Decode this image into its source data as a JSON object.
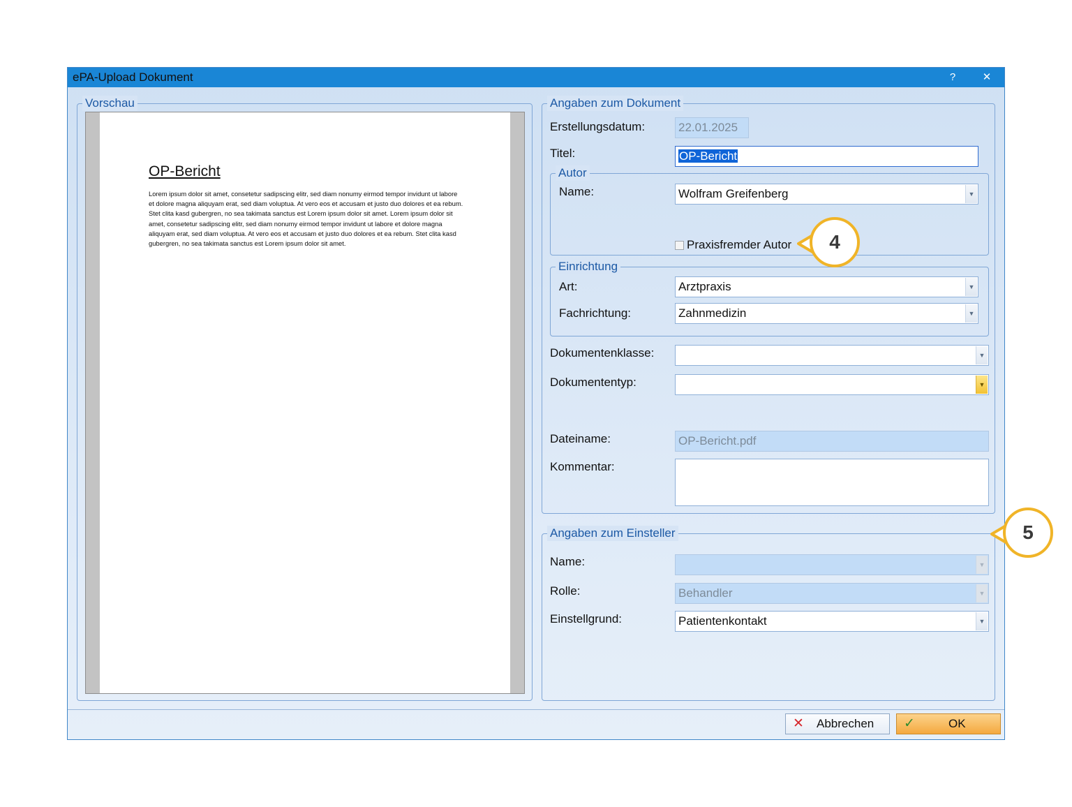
{
  "window": {
    "title": "ePA-Upload Dokument",
    "help_label": "?",
    "close_label": "✕"
  },
  "preview": {
    "legend": "Vorschau",
    "doc_title": "OP-Bericht",
    "doc_text": "Lorem ipsum dolor sit amet, consetetur sadipscing elitr, sed diam nonumy eirmod tempor invidunt ut labore et dolore magna aliquyam erat, sed diam voluptua. At vero eos et accusam et justo duo dolores et ea rebum. Stet clita kasd gubergren, no sea takimata sanctus est Lorem ipsum dolor sit amet. Lorem ipsum dolor sit amet, consetetur sadipscing elitr, sed diam nonumy eirmod tempor invidunt ut labore et dolore magna aliquyam erat, sed diam voluptua. At vero eos et accusam et justo duo dolores et ea rebum. Stet clita kasd gubergren, no sea takimata sanctus est Lorem ipsum dolor sit amet."
  },
  "document": {
    "legend": "Angaben zum Dokument",
    "erstellungsdatum_label": "Erstellungsdatum:",
    "erstellungsdatum_value": "22.01.2025",
    "titel_label": "Titel:",
    "titel_value": "OP-Bericht",
    "autor": {
      "legend": "Autor",
      "name_label": "Name:",
      "name_value": "Wolfram Greifenberg",
      "praxisfremd_label": "Praxisfremder Autor",
      "praxisfremd_checked": false
    },
    "einrichtung": {
      "legend": "Einrichtung",
      "art_label": "Art:",
      "art_value": "Arztpraxis",
      "fach_label": "Fachrichtung:",
      "fach_value": "Zahnmedizin"
    },
    "klasse_label": "Dokumentenklasse:",
    "klasse_value": "",
    "typ_label": "Dokumententyp:",
    "typ_value": "",
    "dateiname_label": "Dateiname:",
    "dateiname_value": "OP-Bericht.pdf",
    "kommentar_label": "Kommentar:",
    "kommentar_value": ""
  },
  "einsteller": {
    "legend": "Angaben zum Einsteller",
    "name_label": "Name:",
    "name_value": "",
    "rolle_label": "Rolle:",
    "rolle_value": "Behandler",
    "grund_label": "Einstellgrund:",
    "grund_value": "Patientenkontakt"
  },
  "buttons": {
    "cancel_label": "Abbrechen",
    "ok_label": "OK"
  },
  "callouts": {
    "c4": "4",
    "c5": "5"
  },
  "colors": {
    "titlebar": "#1a86d6",
    "legend_text": "#1c59a5",
    "callout_ring": "#f0b428",
    "ok_button": "#f7b14e",
    "cancel_icon": "#d6262b",
    "ok_icon": "#2e8b2e"
  },
  "icons": {
    "cancel": "x-icon",
    "ok": "checkmark-icon",
    "dropdown": "chevron-down-icon"
  }
}
